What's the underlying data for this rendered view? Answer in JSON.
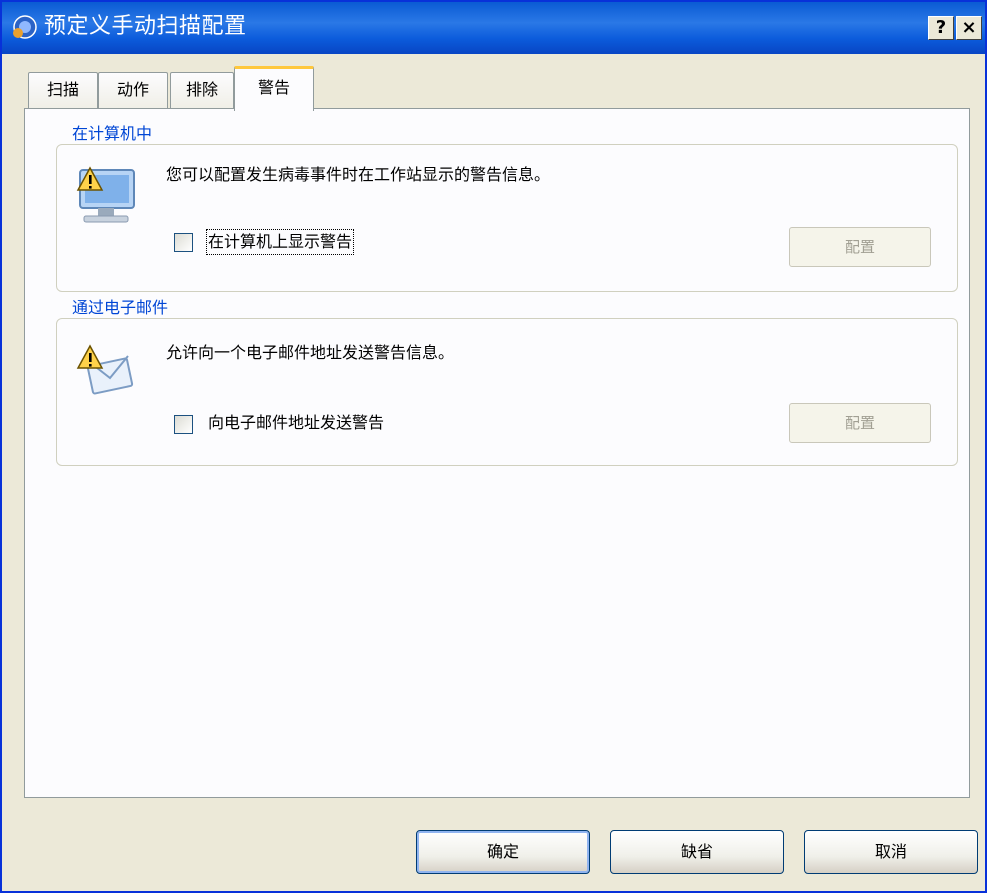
{
  "window": {
    "title": "预定义手动扫描配置",
    "help_label": "?",
    "close_label": "×"
  },
  "tabs": [
    {
      "label": "扫描"
    },
    {
      "label": "动作"
    },
    {
      "label": "排除"
    },
    {
      "label": "警告"
    }
  ],
  "group_computer": {
    "title": "在计算机中",
    "description": "您可以配置发生病毒事件时在工作站显示的警告信息。",
    "checkbox_label": "在计算机上显示警告",
    "checked": false,
    "config_button": "配置"
  },
  "group_email": {
    "title": "通过电子邮件",
    "description": "允许向一个电子邮件地址发送警告信息。",
    "checkbox_label": "向电子邮件地址发送警告",
    "checked": false,
    "config_button": "配置"
  },
  "footer": {
    "ok_label": "确定",
    "default_label": "缺省",
    "cancel_label": "取消"
  },
  "colors": {
    "titlebar": "#0a5bd4",
    "group_title": "#0046d5",
    "active_tab_accent": "#ffc83c",
    "window_bg": "#ece9d8"
  },
  "icons": {
    "app": "app-shield-icon",
    "computer_warning": "computer-warning-icon",
    "email_warning": "email-warning-icon"
  }
}
